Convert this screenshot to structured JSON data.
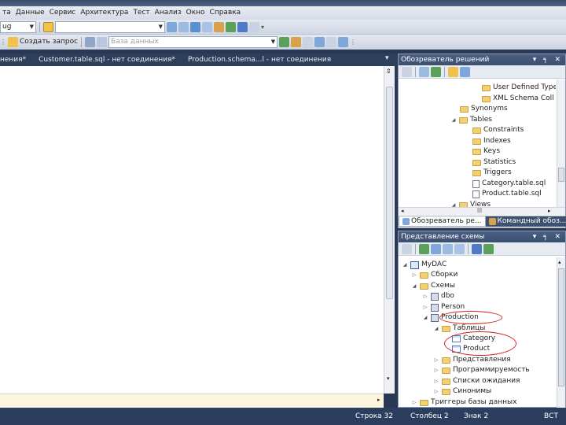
{
  "menubar": {
    "items": [
      "та",
      "Данные",
      "Сервис",
      "Архитектура",
      "Тест",
      "Анализ",
      "Окно",
      "Справка"
    ]
  },
  "toolbar1": {
    "config_combo_value": "ug",
    "search_combo_value": ""
  },
  "toolbar2": {
    "new_query_label": "Создать запрос",
    "database_combo_value": "База данных"
  },
  "doc_tabs": [
    "нения*",
    "Customer.table.sql - нет соединения*",
    "Production.schema...l - нет соединения"
  ],
  "solution_explorer": {
    "title": "Обозреватель решений",
    "nodes": [
      "User Defined Type",
      "XML Schema Coll",
      "Synonyms",
      "Tables",
      "Constraints",
      "Indexes",
      "Keys",
      "Statistics",
      "Triggers",
      "Category.table.sql",
      "Product.table.sql",
      "Views"
    ],
    "tab_active": "Обозреватель ре...",
    "tab_inactive": "Командный обоз..."
  },
  "schema_view": {
    "title": "Представление схемы",
    "nodes": [
      "MyDAC",
      "Сборки",
      "Схемы",
      "dbo",
      "Person",
      "Production",
      "Таблицы",
      "Category",
      "Product",
      "Представления",
      "Программируемость",
      "Списки ожидания",
      "Синонимы",
      "Триггеры базы данных"
    ]
  },
  "statusbar": {
    "line": "Строка 32",
    "column": "Столбец 2",
    "char": "Знак 2",
    "mode": "ВСТ"
  },
  "colors": {
    "chrome_dark": "#293955",
    "annotation_red": "#d62020"
  }
}
